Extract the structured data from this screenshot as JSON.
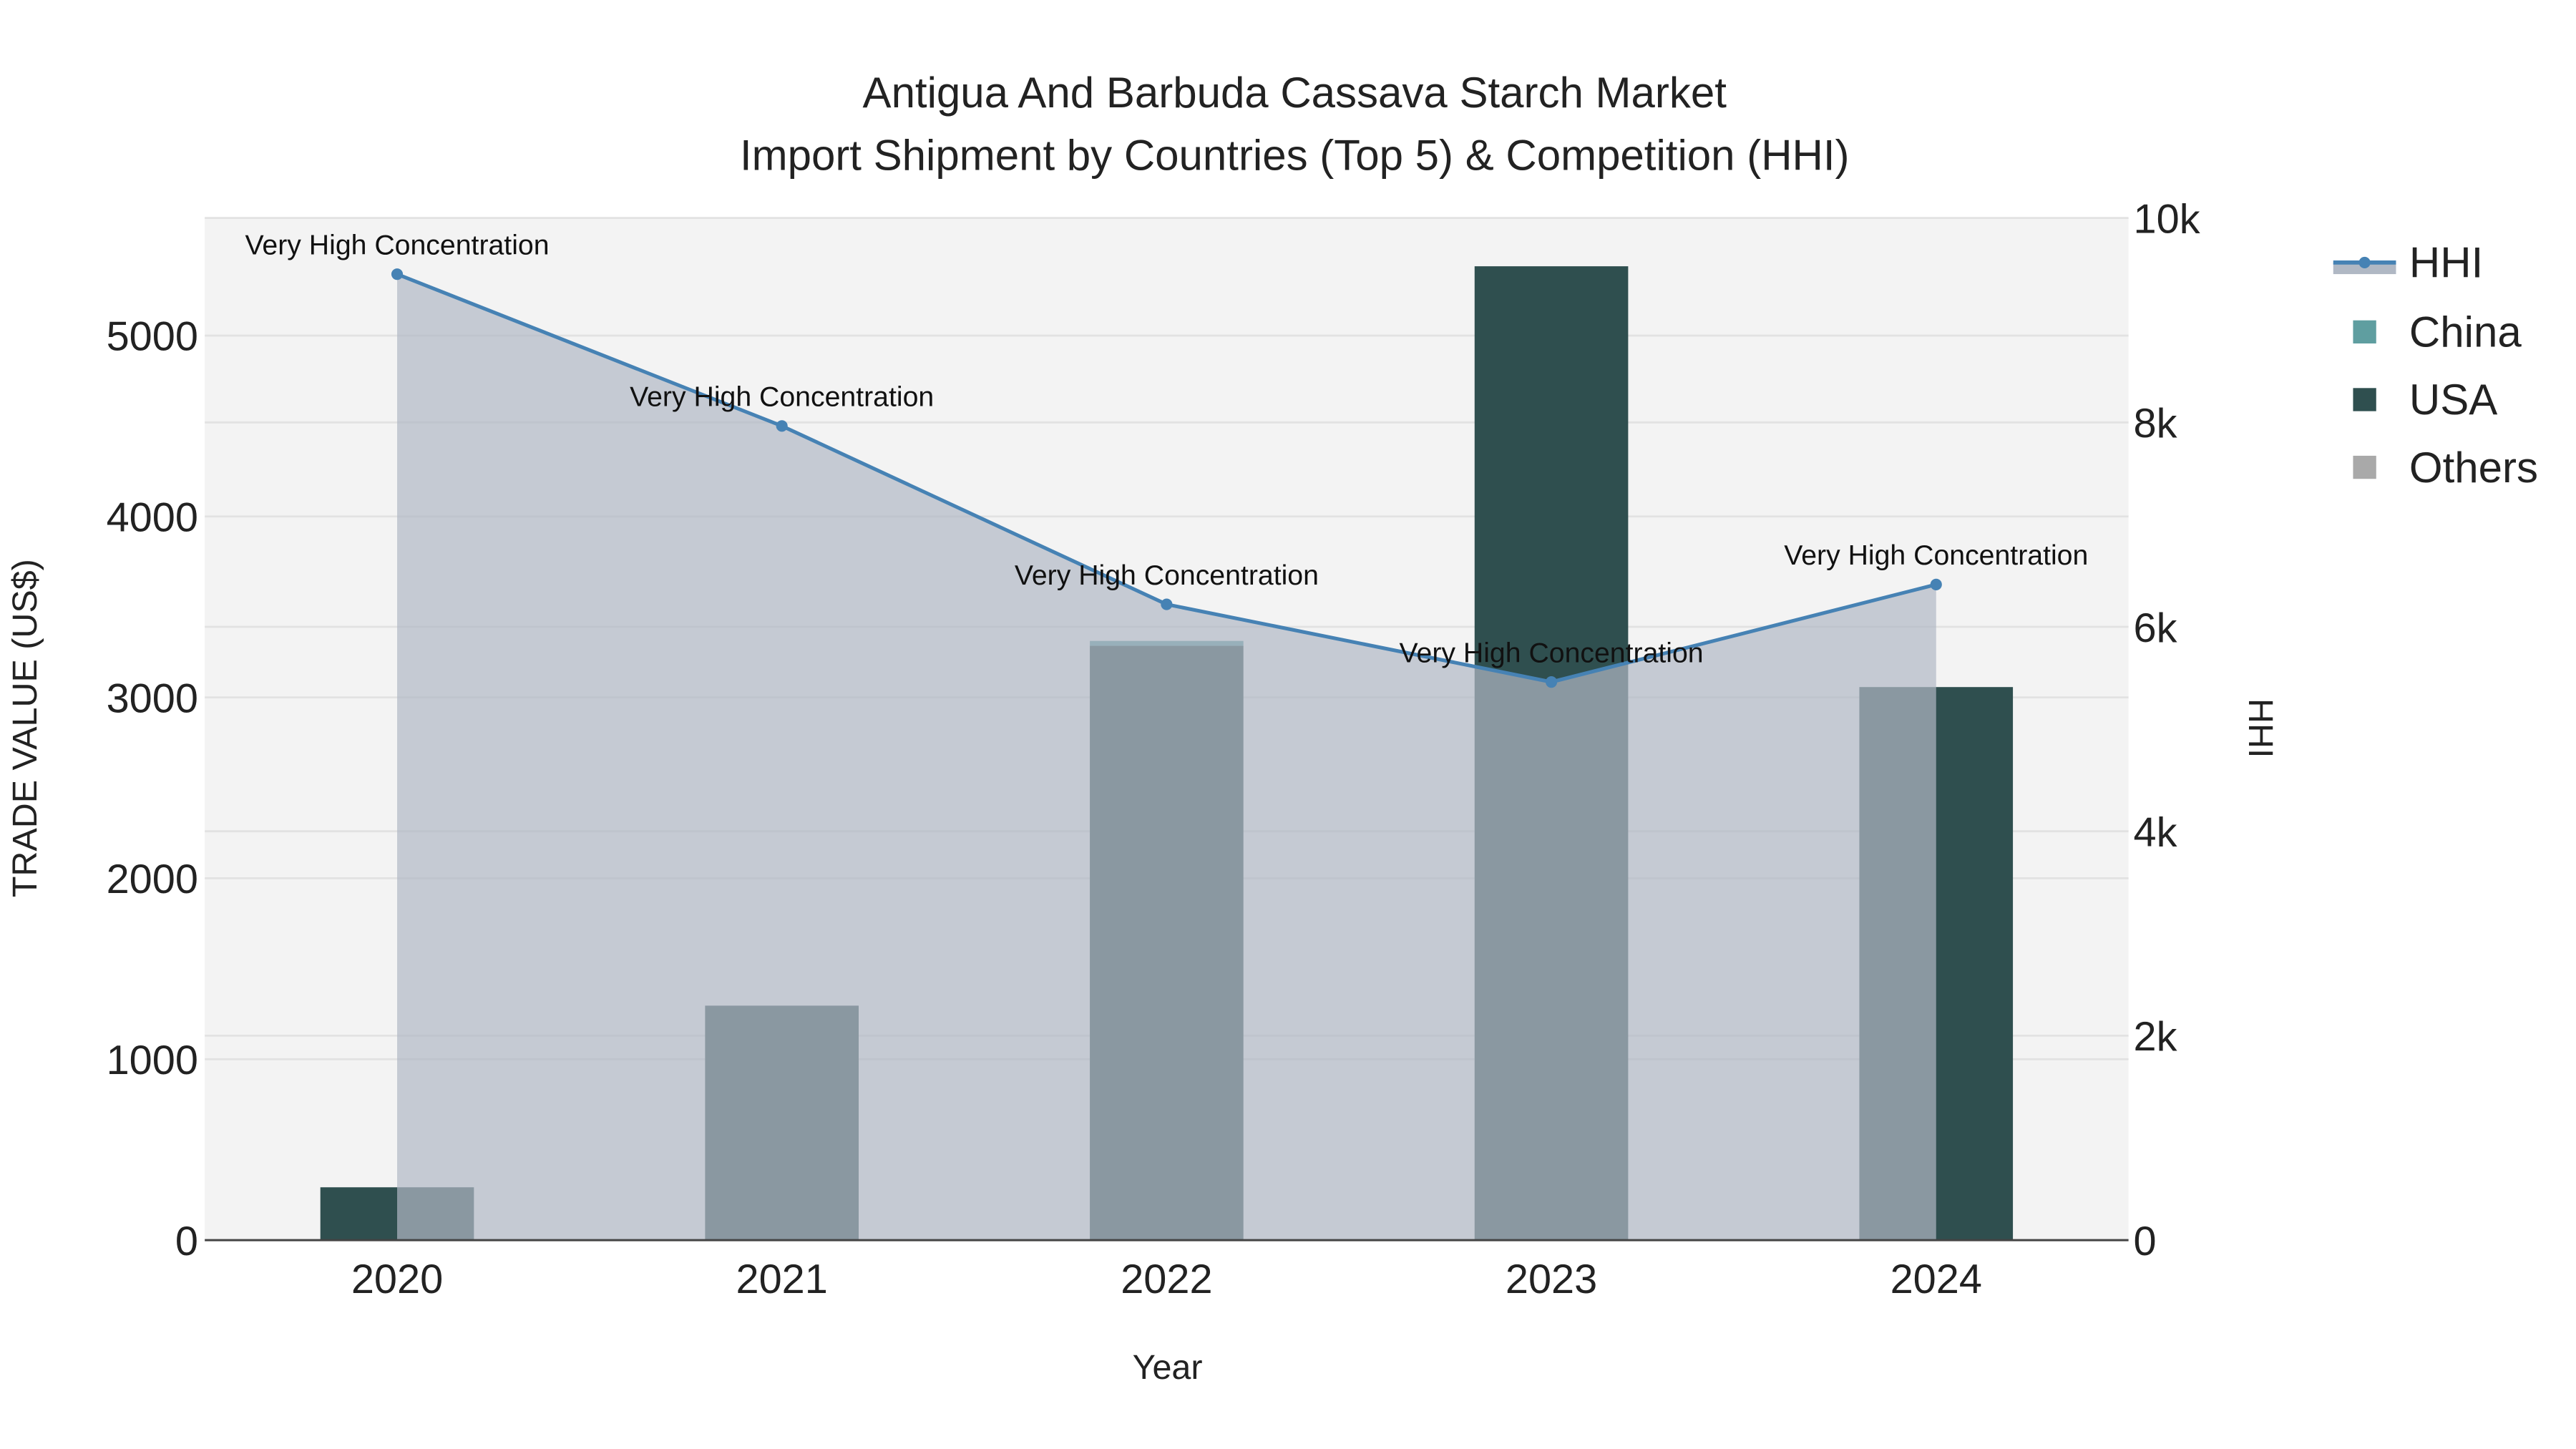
{
  "chart_data": {
    "type": "bar",
    "title": "Antigua And Barbuda Cassava Starch Market",
    "subtitle": "Import Shipment by Countries (Top 5) & Competition (HHI)",
    "xlabel": "Year",
    "ylabel": "TRADE VALUE (US$)",
    "y2label": "HHI",
    "categories": [
      "2020",
      "2021",
      "2022",
      "2023",
      "2024"
    ],
    "ylim": [
      0,
      5650
    ],
    "yticks": [
      0,
      1000,
      2000,
      3000,
      4000,
      5000
    ],
    "ytick_labels": [
      "0",
      "1000",
      "2000",
      "3000",
      "4000",
      "5000"
    ],
    "y2lim": [
      0,
      10000
    ],
    "y2ticks": [
      0,
      2000,
      4000,
      6000,
      8000,
      10000
    ],
    "y2tick_labels": [
      "0",
      "2k",
      "4k",
      "6k",
      "8k",
      "10k"
    ],
    "grid": true,
    "legend_position": "right",
    "series": [
      {
        "name": "China",
        "kind": "bar",
        "color": "#5f9ea0",
        "values": [
          0,
          0,
          27,
          0,
          0
        ]
      },
      {
        "name": "USA",
        "kind": "bar",
        "color": "#2f4f4f",
        "values": [
          292,
          1296,
          3285,
          5383,
          3057
        ]
      },
      {
        "name": "Others",
        "kind": "bar",
        "color": "#a9a9a9",
        "values": [
          0,
          0,
          0,
          0,
          0
        ]
      },
      {
        "name": "HHI",
        "kind": "line-area",
        "axis": "y2",
        "color": "#4682b4",
        "fill": "#b0b8c4",
        "values": [
          9450,
          7965,
          6220,
          5460,
          6414
        ],
        "annotations": [
          "Very High Concentration",
          "Very High Concentration",
          "Very High Concentration",
          "Very High Concentration",
          "Very High Concentration"
        ]
      }
    ],
    "legend": [
      "HHI",
      "China",
      "USA",
      "Others"
    ]
  }
}
